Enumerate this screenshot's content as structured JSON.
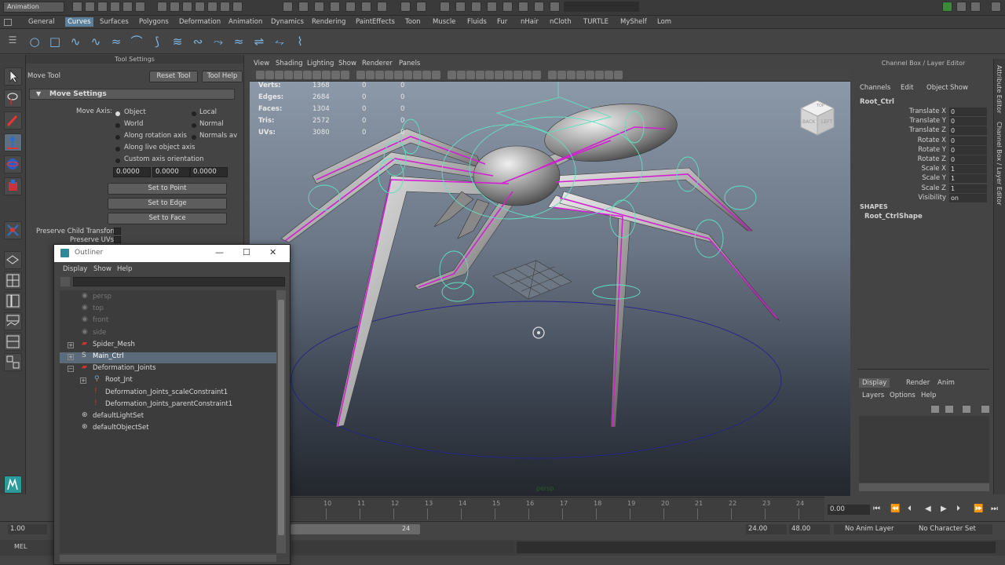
{
  "topbar": {
    "mode": "Animation"
  },
  "shelf": {
    "tabs": [
      "General",
      "Curves",
      "Surfaces",
      "Polygons",
      "Deformation",
      "Animation",
      "Dynamics",
      "Rendering",
      "PaintEffects",
      "Toon",
      "Muscle",
      "Fluids",
      "Fur",
      "nHair",
      "nCloth",
      "TURTLE",
      "MyShelf",
      "Lom"
    ],
    "active_tab": "Curves"
  },
  "tool_settings": {
    "panel_title": "Tool Settings",
    "tool_name": "Move Tool",
    "reset_button": "Reset Tool",
    "help_button": "Tool Help",
    "section": "Move Settings",
    "move_axis_label": "Move Axis:",
    "axis_options": [
      "Object",
      "World",
      "Along rotation axis",
      "Along live object axis",
      "Custom axis orientation"
    ],
    "axis_options_right": [
      "Local",
      "Normal",
      "Normals av"
    ],
    "selected_axis": "Object",
    "custom_values": [
      "0.0000",
      "0.0000",
      "0.0000"
    ],
    "set_to_point": "Set to Point",
    "set_to_edge": "Set to Edge",
    "set_to_face": "Set to Face",
    "preserve_child": "Preserve Child Transform",
    "preserve_uvs": "Preserve UVs"
  },
  "viewport": {
    "menus": [
      "View",
      "Shading",
      "Lighting",
      "Show",
      "Renderer",
      "Panels"
    ],
    "hud": [
      {
        "label": "Verts:",
        "v1": "1368",
        "v2": "0",
        "v3": "0"
      },
      {
        "label": "Edges:",
        "v1": "2684",
        "v2": "0",
        "v3": "0"
      },
      {
        "label": "Faces:",
        "v1": "1304",
        "v2": "0",
        "v3": "0"
      },
      {
        "label": "Tris:",
        "v1": "2572",
        "v2": "0",
        "v3": "0"
      },
      {
        "label": "UVs:",
        "v1": "3080",
        "v2": "0",
        "v3": "0"
      }
    ],
    "camera_label": "persp",
    "viewcube": {
      "face_a": "BACK",
      "face_b": "LEFT",
      "face_top": "TOP"
    },
    "colors": {
      "joint": "#d21fd2",
      "control": "#5fe0c0",
      "ground_circle": "#2a2aa0"
    }
  },
  "channel_box": {
    "title": "Channel Box / Layer Editor",
    "menus": [
      "Channels",
      "Edit",
      "Object",
      "Show"
    ],
    "object": "Root_Ctrl",
    "attributes": [
      {
        "name": "Translate X",
        "value": "0"
      },
      {
        "name": "Translate Y",
        "value": "0"
      },
      {
        "name": "Translate Z",
        "value": "0"
      },
      {
        "name": "Rotate X",
        "value": "0"
      },
      {
        "name": "Rotate Y",
        "value": "0"
      },
      {
        "name": "Rotate Z",
        "value": "0"
      },
      {
        "name": "Scale X",
        "value": "1"
      },
      {
        "name": "Scale Y",
        "value": "1"
      },
      {
        "name": "Scale Z",
        "value": "1"
      },
      {
        "name": "Visibility",
        "value": "on"
      }
    ],
    "shapes_label": "SHAPES",
    "shape_name": "Root_CtrlShape",
    "layer_tabs": [
      "Display",
      "Render",
      "Anim"
    ],
    "layer_menus": [
      "Layers",
      "Options",
      "Help"
    ],
    "side_tabs": [
      "Attribute Editor",
      "Channel Box / Layer Editor"
    ]
  },
  "timeline": {
    "ticks": [
      "10",
      "11",
      "12",
      "13",
      "14",
      "15",
      "16",
      "17",
      "18",
      "19",
      "20",
      "21",
      "22",
      "23",
      "24"
    ],
    "current_frame": "0.00",
    "range_start": "1.00",
    "range_inner_end": "24",
    "range_end": "24.00",
    "anim_end": "48.00",
    "anim_layer": "No Anim Layer",
    "char_set": "No Character Set"
  },
  "cmdline": {
    "lang": "MEL"
  },
  "outliner": {
    "title": "Outliner",
    "menus": [
      "Display",
      "Show",
      "Help"
    ],
    "items": [
      {
        "name": "persp",
        "dim": true,
        "indent": 0
      },
      {
        "name": "top",
        "dim": true,
        "indent": 0
      },
      {
        "name": "front",
        "dim": true,
        "indent": 0
      },
      {
        "name": "side",
        "dim": true,
        "indent": 0
      },
      {
        "name": "Spider_Mesh",
        "dim": false,
        "indent": 0
      },
      {
        "name": "Main_Ctrl",
        "dim": false,
        "indent": 0
      },
      {
        "name": "Deformation_Joints",
        "dim": false,
        "indent": 0
      },
      {
        "name": "Root_Jnt",
        "dim": false,
        "indent": 1
      },
      {
        "name": "Deformation_Joints_scaleConstraint1",
        "dim": false,
        "indent": 1
      },
      {
        "name": "Deformation_Joints_parentConstraint1",
        "dim": false,
        "indent": 1
      },
      {
        "name": "defaultLightSet",
        "dim": false,
        "indent": 0
      },
      {
        "name": "defaultObjectSet",
        "dim": false,
        "indent": 0
      }
    ]
  }
}
